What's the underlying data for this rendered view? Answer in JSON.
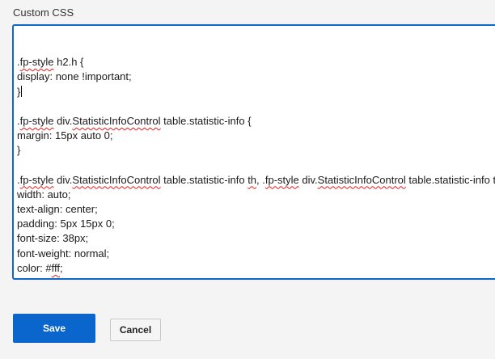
{
  "field": {
    "label": "Custom CSS"
  },
  "editor": {
    "lines": [
      [],
      [
        {
          "t": ".",
          "sq": false
        },
        {
          "t": "fp-style",
          "sq": true
        },
        {
          "t": " h2.h {",
          "sq": false
        }
      ],
      [
        {
          "t": "display: none !important;",
          "sq": false
        }
      ],
      [
        {
          "t": "}",
          "sq": false
        }
      ],
      [],
      [
        {
          "t": ".",
          "sq": false
        },
        {
          "t": "fp-style",
          "sq": true
        },
        {
          "t": " div.",
          "sq": false
        },
        {
          "t": "StatisticInfoControl",
          "sq": true
        },
        {
          "t": " table.statistic-info {",
          "sq": false
        }
      ],
      [
        {
          "t": "margin: 15px auto 0;",
          "sq": false
        }
      ],
      [
        {
          "t": "}",
          "sq": false
        }
      ],
      [],
      [
        {
          "t": ".",
          "sq": false
        },
        {
          "t": "fp-style",
          "sq": true
        },
        {
          "t": " div.",
          "sq": false
        },
        {
          "t": "StatisticInfoControl",
          "sq": true
        },
        {
          "t": " table.statistic-info ",
          "sq": false
        },
        {
          "t": "th",
          "sq": true
        },
        {
          "t": ", .",
          "sq": false
        },
        {
          "t": "fp-style",
          "sq": true
        },
        {
          "t": " div.",
          "sq": false
        },
        {
          "t": "StatisticInfoControl",
          "sq": true
        },
        {
          "t": " table.statistic-info td {",
          "sq": false
        }
      ],
      [
        {
          "t": "width: auto;",
          "sq": false
        }
      ],
      [
        {
          "t": "text-align: center;",
          "sq": false
        }
      ],
      [
        {
          "t": "padding: 5px 15px 0;",
          "sq": false
        }
      ],
      [
        {
          "t": "font-size: 38px;",
          "sq": false
        }
      ],
      [
        {
          "t": "font-weight: normal;",
          "sq": false
        }
      ],
      [
        {
          "t": "color: #",
          "sq": false
        },
        {
          "t": "fff",
          "sq": true
        },
        {
          "t": ";",
          "sq": false
        }
      ],
      [
        {
          "t": "}",
          "sq": false
        }
      ]
    ],
    "caret_line": 3
  },
  "actions": {
    "save_label": "Save",
    "cancel_label": "Cancel"
  },
  "colors": {
    "accent": "#0a66cc",
    "focus_border": "#0f67c7",
    "spellcheck": "#e01b1b"
  }
}
